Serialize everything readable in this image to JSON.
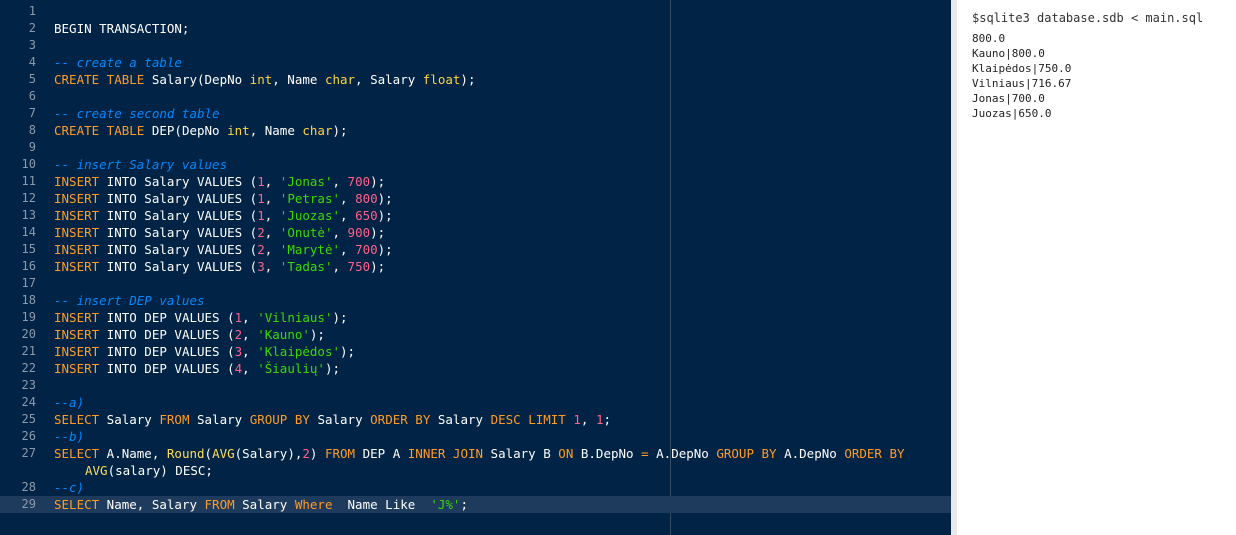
{
  "editor": {
    "lines": [
      {
        "num": "1",
        "tokens": []
      },
      {
        "num": "2",
        "tokens": [
          {
            "t": "BEGIN TRANSACTION;",
            "c": "tx"
          }
        ]
      },
      {
        "num": "3",
        "tokens": []
      },
      {
        "num": "4",
        "tokens": [
          {
            "t": "-- create a table",
            "c": "cm"
          }
        ]
      },
      {
        "num": "5",
        "tokens": [
          {
            "t": "CREATE TABLE",
            "c": "kw"
          },
          {
            "t": " Salary(DepNo ",
            "c": "tx"
          },
          {
            "t": "int",
            "c": "ty"
          },
          {
            "t": ", Name ",
            "c": "tx"
          },
          {
            "t": "char",
            "c": "ty"
          },
          {
            "t": ", Salary ",
            "c": "tx"
          },
          {
            "t": "float",
            "c": "ty"
          },
          {
            "t": ");",
            "c": "tx"
          }
        ]
      },
      {
        "num": "6",
        "tokens": []
      },
      {
        "num": "7",
        "tokens": [
          {
            "t": "-- create second table",
            "c": "cm"
          }
        ]
      },
      {
        "num": "8",
        "tokens": [
          {
            "t": "CREATE TABLE",
            "c": "kw"
          },
          {
            "t": " DEP(DepNo ",
            "c": "tx"
          },
          {
            "t": "int",
            "c": "ty"
          },
          {
            "t": ", Name ",
            "c": "tx"
          },
          {
            "t": "char",
            "c": "ty"
          },
          {
            "t": ");",
            "c": "tx"
          }
        ]
      },
      {
        "num": "9",
        "tokens": []
      },
      {
        "num": "10",
        "tokens": [
          {
            "t": "-- insert Salary values",
            "c": "cm"
          }
        ]
      },
      {
        "num": "11",
        "tokens": [
          {
            "t": "INSERT",
            "c": "kw"
          },
          {
            "t": " INTO Salary VALUES (",
            "c": "tx"
          },
          {
            "t": "1",
            "c": "num"
          },
          {
            "t": ", ",
            "c": "tx"
          },
          {
            "t": "'Jonas'",
            "c": "str"
          },
          {
            "t": ", ",
            "c": "tx"
          },
          {
            "t": "700",
            "c": "num"
          },
          {
            "t": ");",
            "c": "tx"
          }
        ]
      },
      {
        "num": "12",
        "tokens": [
          {
            "t": "INSERT",
            "c": "kw"
          },
          {
            "t": " INTO Salary VALUES (",
            "c": "tx"
          },
          {
            "t": "1",
            "c": "num"
          },
          {
            "t": ", ",
            "c": "tx"
          },
          {
            "t": "'Petras'",
            "c": "str"
          },
          {
            "t": ", ",
            "c": "tx"
          },
          {
            "t": "800",
            "c": "num"
          },
          {
            "t": ");",
            "c": "tx"
          }
        ]
      },
      {
        "num": "13",
        "tokens": [
          {
            "t": "INSERT",
            "c": "kw"
          },
          {
            "t": " INTO Salary VALUES (",
            "c": "tx"
          },
          {
            "t": "1",
            "c": "num"
          },
          {
            "t": ", ",
            "c": "tx"
          },
          {
            "t": "'Juozas'",
            "c": "str"
          },
          {
            "t": ", ",
            "c": "tx"
          },
          {
            "t": "650",
            "c": "num"
          },
          {
            "t": ");",
            "c": "tx"
          }
        ]
      },
      {
        "num": "14",
        "tokens": [
          {
            "t": "INSERT",
            "c": "kw"
          },
          {
            "t": " INTO Salary VALUES (",
            "c": "tx"
          },
          {
            "t": "2",
            "c": "num"
          },
          {
            "t": ", ",
            "c": "tx"
          },
          {
            "t": "'Onutė'",
            "c": "str"
          },
          {
            "t": ", ",
            "c": "tx"
          },
          {
            "t": "900",
            "c": "num"
          },
          {
            "t": ");",
            "c": "tx"
          }
        ]
      },
      {
        "num": "15",
        "tokens": [
          {
            "t": "INSERT",
            "c": "kw"
          },
          {
            "t": " INTO Salary VALUES (",
            "c": "tx"
          },
          {
            "t": "2",
            "c": "num"
          },
          {
            "t": ", ",
            "c": "tx"
          },
          {
            "t": "'Marytė'",
            "c": "str"
          },
          {
            "t": ", ",
            "c": "tx"
          },
          {
            "t": "700",
            "c": "num"
          },
          {
            "t": ");",
            "c": "tx"
          }
        ]
      },
      {
        "num": "16",
        "tokens": [
          {
            "t": "INSERT",
            "c": "kw"
          },
          {
            "t": " INTO Salary VALUES (",
            "c": "tx"
          },
          {
            "t": "3",
            "c": "num"
          },
          {
            "t": ", ",
            "c": "tx"
          },
          {
            "t": "'Tadas'",
            "c": "str"
          },
          {
            "t": ", ",
            "c": "tx"
          },
          {
            "t": "750",
            "c": "num"
          },
          {
            "t": ");",
            "c": "tx"
          }
        ]
      },
      {
        "num": "17",
        "tokens": []
      },
      {
        "num": "18",
        "tokens": [
          {
            "t": "-- insert DEP values",
            "c": "cm"
          }
        ]
      },
      {
        "num": "19",
        "tokens": [
          {
            "t": "INSERT",
            "c": "kw"
          },
          {
            "t": " INTO DEP VALUES (",
            "c": "tx"
          },
          {
            "t": "1",
            "c": "num"
          },
          {
            "t": ", ",
            "c": "tx"
          },
          {
            "t": "'Vilniaus'",
            "c": "str"
          },
          {
            "t": ");",
            "c": "tx"
          }
        ]
      },
      {
        "num": "20",
        "tokens": [
          {
            "t": "INSERT",
            "c": "kw"
          },
          {
            "t": " INTO DEP VALUES (",
            "c": "tx"
          },
          {
            "t": "2",
            "c": "num"
          },
          {
            "t": ", ",
            "c": "tx"
          },
          {
            "t": "'Kauno'",
            "c": "str"
          },
          {
            "t": ");",
            "c": "tx"
          }
        ]
      },
      {
        "num": "21",
        "tokens": [
          {
            "t": "INSERT",
            "c": "kw"
          },
          {
            "t": " INTO DEP VALUES (",
            "c": "tx"
          },
          {
            "t": "3",
            "c": "num"
          },
          {
            "t": ", ",
            "c": "tx"
          },
          {
            "t": "'Klaipėdos'",
            "c": "str"
          },
          {
            "t": ");",
            "c": "tx"
          }
        ]
      },
      {
        "num": "22",
        "tokens": [
          {
            "t": "INSERT",
            "c": "kw"
          },
          {
            "t": " INTO DEP VALUES (",
            "c": "tx"
          },
          {
            "t": "4",
            "c": "num"
          },
          {
            "t": ", ",
            "c": "tx"
          },
          {
            "t": "'Šiaulių'",
            "c": "str"
          },
          {
            "t": ");",
            "c": "tx"
          }
        ]
      },
      {
        "num": "23",
        "tokens": []
      },
      {
        "num": "24",
        "tokens": [
          {
            "t": "--a)",
            "c": "cm"
          }
        ]
      },
      {
        "num": "25",
        "tokens": [
          {
            "t": "SELECT",
            "c": "kw"
          },
          {
            "t": " Salary ",
            "c": "tx"
          },
          {
            "t": "FROM",
            "c": "kw"
          },
          {
            "t": " Salary ",
            "c": "tx"
          },
          {
            "t": "GROUP BY",
            "c": "kw"
          },
          {
            "t": " Salary ",
            "c": "tx"
          },
          {
            "t": "ORDER BY",
            "c": "kw"
          },
          {
            "t": " Salary ",
            "c": "tx"
          },
          {
            "t": "DESC LIMIT",
            "c": "kw"
          },
          {
            "t": " ",
            "c": "tx"
          },
          {
            "t": "1",
            "c": "num"
          },
          {
            "t": ", ",
            "c": "tx"
          },
          {
            "t": "1",
            "c": "num"
          },
          {
            "t": ";",
            "c": "tx"
          }
        ]
      },
      {
        "num": "26",
        "tokens": [
          {
            "t": "--b)",
            "c": "cm"
          }
        ]
      },
      {
        "num": "27",
        "tokens": [
          {
            "t": "SELECT",
            "c": "kw"
          },
          {
            "t": " A.Name, ",
            "c": "tx"
          },
          {
            "t": "Round",
            "c": "fn"
          },
          {
            "t": "(",
            "c": "tx"
          },
          {
            "t": "AVG",
            "c": "fn"
          },
          {
            "t": "(Salary),",
            "c": "tx"
          },
          {
            "t": "2",
            "c": "num"
          },
          {
            "t": ") ",
            "c": "tx"
          },
          {
            "t": "FROM",
            "c": "kw"
          },
          {
            "t": " DEP A ",
            "c": "tx"
          },
          {
            "t": "INNER JOIN",
            "c": "kw"
          },
          {
            "t": " Salary B ",
            "c": "tx"
          },
          {
            "t": "ON",
            "c": "kw"
          },
          {
            "t": " B.DepNo ",
            "c": "tx"
          },
          {
            "t": "=",
            "c": "kw"
          },
          {
            "t": " A.DepNo ",
            "c": "tx"
          },
          {
            "t": "GROUP BY",
            "c": "kw"
          },
          {
            "t": " A.DepNo ",
            "c": "tx"
          },
          {
            "t": "ORDER BY",
            "c": "kw"
          }
        ]
      },
      {
        "num": "",
        "wrap": true,
        "tokens": [
          {
            "t": "AVG",
            "c": "fn"
          },
          {
            "t": "(salary) DESC;",
            "c": "tx"
          }
        ]
      },
      {
        "num": "28",
        "tokens": [
          {
            "t": "--c)",
            "c": "cm"
          }
        ]
      },
      {
        "num": "29",
        "active": true,
        "tokens": [
          {
            "t": "SELECT",
            "c": "kw"
          },
          {
            "t": " Name, Salary ",
            "c": "tx"
          },
          {
            "t": "FROM",
            "c": "kw"
          },
          {
            "t": " Salary ",
            "c": "tx"
          },
          {
            "t": "Where",
            "c": "kw"
          },
          {
            "t": "  Name Like  ",
            "c": "tx"
          },
          {
            "t": "'J%'",
            "c": "str"
          },
          {
            "t": ";",
            "c": "tx"
          }
        ]
      }
    ]
  },
  "output": {
    "command": "$sqlite3 database.sdb < main.sql",
    "lines": [
      "800.0",
      "Kauno|800.0",
      "Klaipėdos|750.0",
      "Vilniaus|716.67",
      "Jonas|700.0",
      "Juozas|650.0"
    ]
  }
}
